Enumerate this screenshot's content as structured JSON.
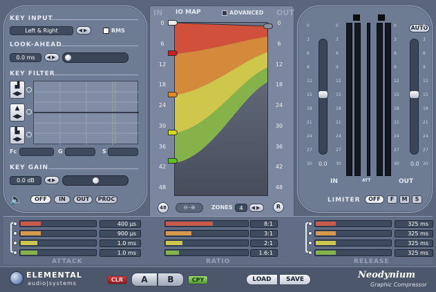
{
  "key_input": {
    "title": "KEY INPUT",
    "mode_value": "Left & Right",
    "rms_label": "RMS"
  },
  "look_ahead": {
    "title": "LOOK-AHEAD",
    "value": "0.0 ms",
    "slider_level": 0.0
  },
  "key_filter": {
    "title": "KEY FILTER",
    "fc_label": "Fc",
    "g_label": "G",
    "s_label": "S"
  },
  "key_gain": {
    "title": "KEY GAIN",
    "value": "0.0 dB",
    "slider_level": 0.5
  },
  "monitor": {
    "off": "OFF",
    "in": "IN",
    "out": "OUT",
    "proc": "PROC"
  },
  "io_map": {
    "in_label": "IN",
    "title": "IO MAP",
    "advanced_label": "ADVANCED",
    "out_label": "OUT",
    "ticks": [
      "0",
      "6",
      "12",
      "18",
      "24",
      "30",
      "36",
      "42",
      "48"
    ],
    "zones_label": "ZONES",
    "zones_value": "4",
    "r_button": "R",
    "db48_button": "48",
    "zone_colors": [
      "#d0503c",
      "#d48a3a",
      "#cfc64c",
      "#86b24a"
    ],
    "zone_handle_colors": [
      "#e8e8e8",
      "#cc2020",
      "#e08a20",
      "#d8d820",
      "#5cc020"
    ]
  },
  "limiter_panel": {
    "left_ticks": [
      "0",
      "3",
      "6",
      "9",
      "12",
      "15",
      "18",
      "21",
      "24",
      "27",
      "30"
    ],
    "right_ticks": [
      "0",
      "3",
      "6",
      "9",
      "12",
      "15",
      "18",
      "21",
      "24",
      "27",
      "30"
    ],
    "left_scale": [
      "0",
      "3",
      "6",
      "9",
      "12",
      "15",
      "18",
      "21",
      "24",
      "27",
      "30"
    ],
    "in_value": "0.0",
    "out_value": "0.0",
    "auto_button": "AUTO",
    "in_label": "IN",
    "att_label": "ATT",
    "out_label": "OUT",
    "limiter_label": "LIMITER",
    "off": "OFF",
    "f": "F",
    "m": "M",
    "s": "S"
  },
  "attack": {
    "title": "ATTACK",
    "values": [
      "400 µs",
      "900 µs",
      "1.0 ms",
      "1.0 ms"
    ],
    "fills": [
      0.27,
      0.27,
      0.22,
      0.22
    ]
  },
  "ratio": {
    "title": "RATIO",
    "values": [
      "8:1",
      "3:1",
      "2:1",
      "1.6:1"
    ],
    "fills": [
      0.58,
      0.31,
      0.2,
      0.16
    ]
  },
  "release": {
    "title": "RELEASE",
    "values": [
      "325 ms",
      "325 ms",
      "325 ms",
      "325 ms"
    ],
    "fills": [
      0.27,
      0.27,
      0.27,
      0.27
    ]
  },
  "footer": {
    "brand_top": "ELEMENTAL",
    "brand_bottom": "audio|systems",
    "clr": "CLR",
    "a": "A",
    "b": "B",
    "cpy": "CPY",
    "load": "LOAD",
    "save": "SAVE",
    "product": "Neodynium",
    "subtitle": "Graphic Compressor"
  },
  "colors": {
    "attack": [
      "#cc5a4a",
      "#d89a4a",
      "#cfc64c",
      "#86b24a"
    ]
  }
}
